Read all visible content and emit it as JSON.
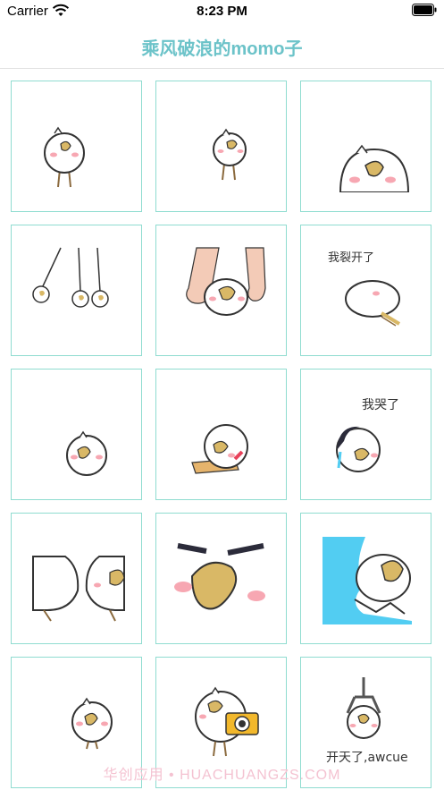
{
  "status_bar": {
    "carrier": "Carrier",
    "time": "8:23 PM"
  },
  "nav": {
    "title": "乘风破浪的momo子"
  },
  "stickers": [
    {
      "id": "sticker-1"
    },
    {
      "id": "sticker-2"
    },
    {
      "id": "sticker-3"
    },
    {
      "id": "sticker-4"
    },
    {
      "id": "sticker-5"
    },
    {
      "id": "sticker-6",
      "caption": "我裂开了"
    },
    {
      "id": "sticker-7"
    },
    {
      "id": "sticker-8"
    },
    {
      "id": "sticker-9",
      "caption": "我哭了"
    },
    {
      "id": "sticker-10"
    },
    {
      "id": "sticker-11"
    },
    {
      "id": "sticker-12"
    },
    {
      "id": "sticker-13"
    },
    {
      "id": "sticker-14"
    },
    {
      "id": "sticker-15",
      "caption": "开天了,awcue"
    }
  ],
  "watermark": "华创应用 • HUACHUANGZS.COM",
  "colors": {
    "accent": "#6cc3c9",
    "cell_border": "#8fdcd0",
    "beak": "#d9b866",
    "blush": "#f7a7b2",
    "blue": "#52cdf2",
    "camera": "#f2b82c"
  }
}
